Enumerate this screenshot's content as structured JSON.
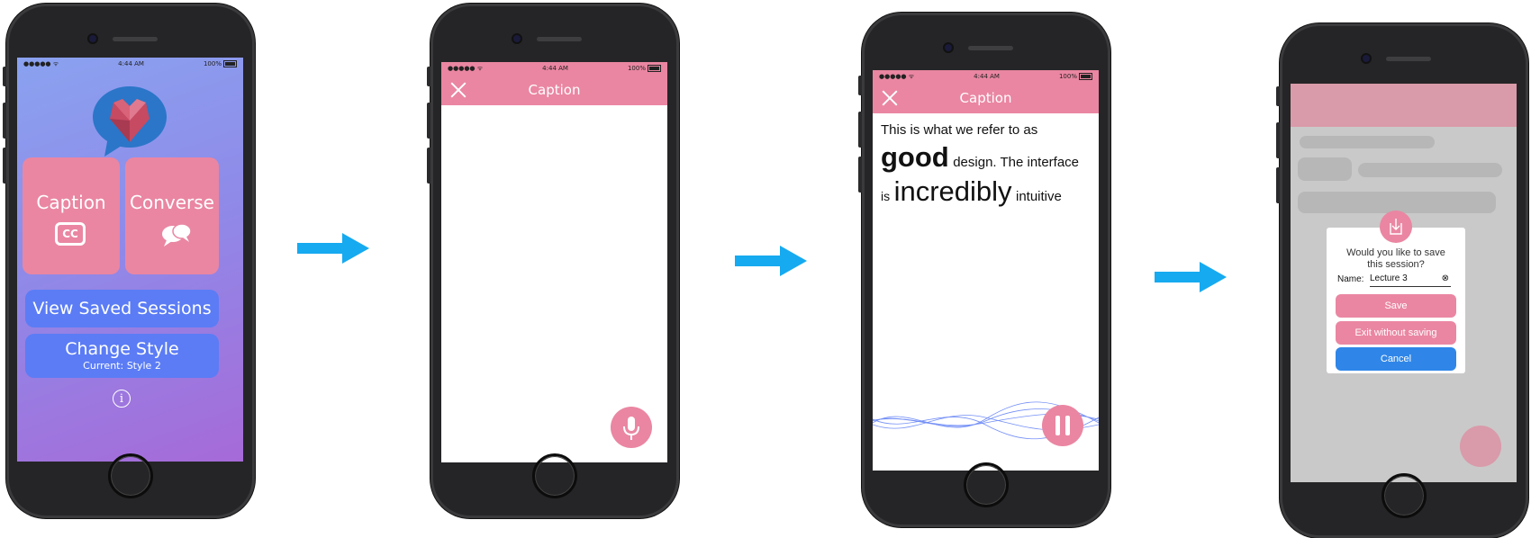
{
  "status_bar": {
    "signal": "●●●●● ᯤ",
    "time": "4:44 AM",
    "battery": "100%"
  },
  "home_screen": {
    "caption_tile": "Caption",
    "cc_icon_text": "CC",
    "converse_tile": "Converse",
    "saved_sessions_button": "View Saved Sessions",
    "change_style_button": "Change Style",
    "current_style": "Current: Style 2",
    "info_icon": "i"
  },
  "caption_screen": {
    "title": "Caption"
  },
  "captioning_screen": {
    "title": "Caption",
    "line1": "This is what we refer to as",
    "word_good": "good",
    "line2_rest": "design. The interface",
    "word_is": "is",
    "word_incredibly": "incredibly",
    "word_intuitive": "intuitive"
  },
  "save_dialog": {
    "question": "Would you like to save this session?",
    "name_label": "Name:",
    "name_value": "Lecture 3",
    "save_button": "Save",
    "exit_button": "Exit without saving",
    "cancel_button": "Cancel"
  },
  "colors": {
    "accent_pink": "#ea86a2",
    "accent_blue": "#5b7cf5",
    "arrow_blue": "#16aaf0",
    "cancel_blue": "#2f86e8"
  },
  "icons": [
    "heart-chat-logo-icon",
    "cc-icon",
    "chat-bubbles-icon",
    "info-icon",
    "close-icon",
    "microphone-icon",
    "pause-icon",
    "save-download-icon",
    "clear-field-icon",
    "arrow-right-icon"
  ]
}
